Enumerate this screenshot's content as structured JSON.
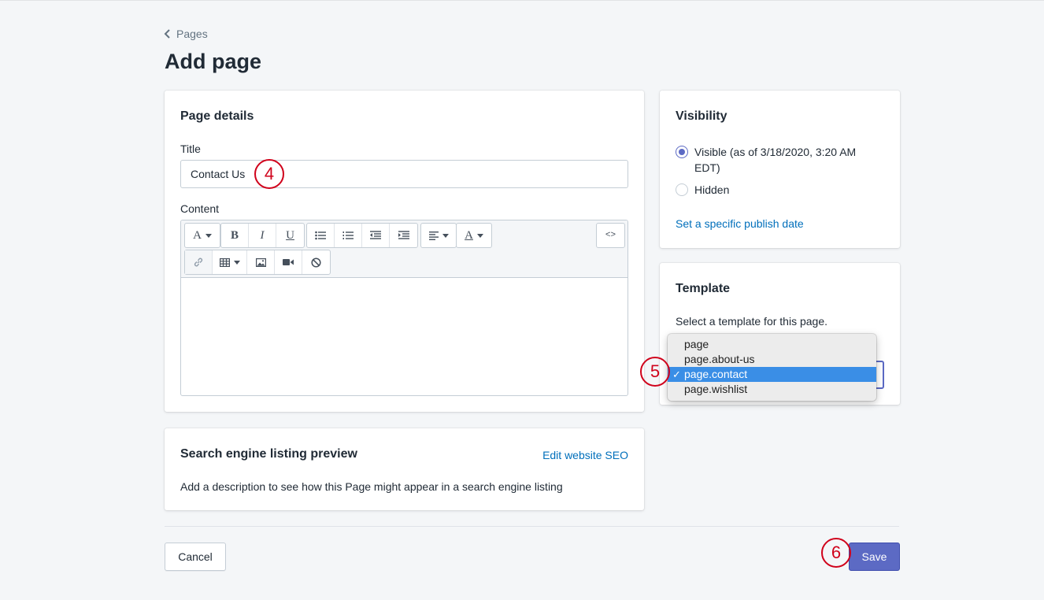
{
  "breadcrumb": {
    "label": "Pages"
  },
  "page_title": "Add page",
  "page_details": {
    "heading": "Page details",
    "title_label": "Title",
    "title_value": "Contact Us",
    "content_label": "Content",
    "toolbar": {
      "font_icon": "A",
      "bold": "B",
      "italic": "I",
      "underline": "U",
      "text_color_icon": "A",
      "html_toggle": "<>"
    }
  },
  "seo": {
    "heading": "Search engine listing preview",
    "edit_link": "Edit website SEO",
    "description": "Add a description to see how this Page might appear in a search engine listing"
  },
  "visibility": {
    "heading": "Visibility",
    "options": [
      {
        "label": "Visible (as of 3/18/2020, 3:20 AM EDT)",
        "checked": true
      },
      {
        "label": "Hidden",
        "checked": false
      }
    ],
    "publish_link": "Set a specific publish date"
  },
  "template": {
    "heading": "Template",
    "description": "Select a template for this page.",
    "options": [
      "page",
      "page.about-us",
      "page.contact",
      "page.wishlist"
    ],
    "selected": "page.contact",
    "check": "✓"
  },
  "actions": {
    "cancel": "Cancel",
    "save": "Save"
  },
  "markers": [
    "4",
    "5",
    "6"
  ],
  "colors": {
    "primary": "#5c6ac4",
    "link": "#006fbb",
    "marker": "#d0021b",
    "highlight": "#3a8ee6"
  }
}
